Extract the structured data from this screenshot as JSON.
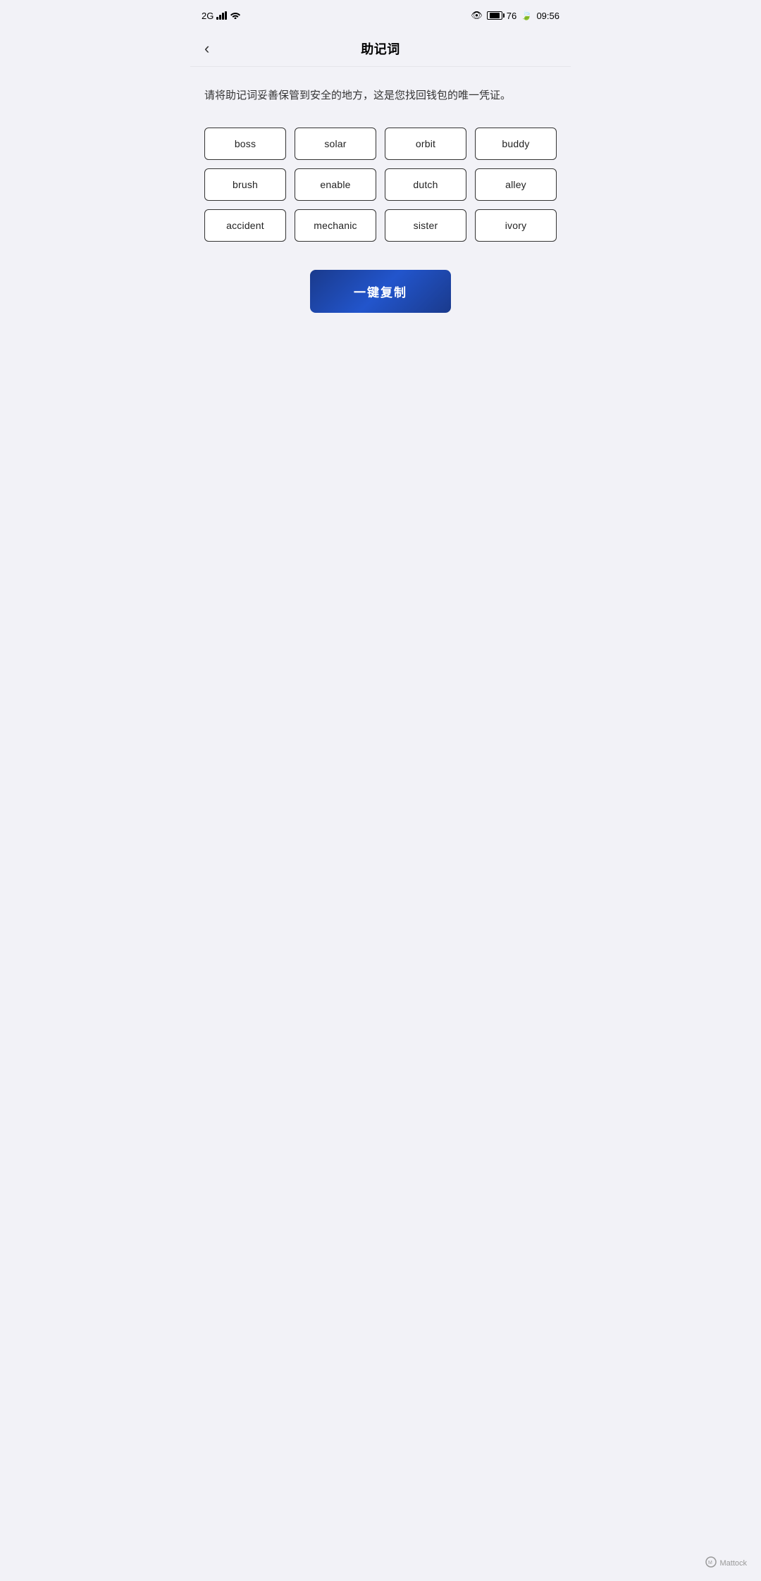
{
  "statusBar": {
    "network": "2G",
    "time": "09:56",
    "batteryLevel": 76,
    "batteryLabel": "76"
  },
  "nav": {
    "backIcon": "‹",
    "title": "助记词"
  },
  "description": "请将助记词妥善保管到安全的地方，这是您找回钱包的唯一凭证。",
  "words": [
    "boss",
    "solar",
    "orbit",
    "buddy",
    "brush",
    "enable",
    "dutch",
    "alley",
    "accident",
    "mechanic",
    "sister",
    "ivory"
  ],
  "copyButton": {
    "label": "一键复制"
  },
  "footer": {
    "brand": "Mattock"
  }
}
